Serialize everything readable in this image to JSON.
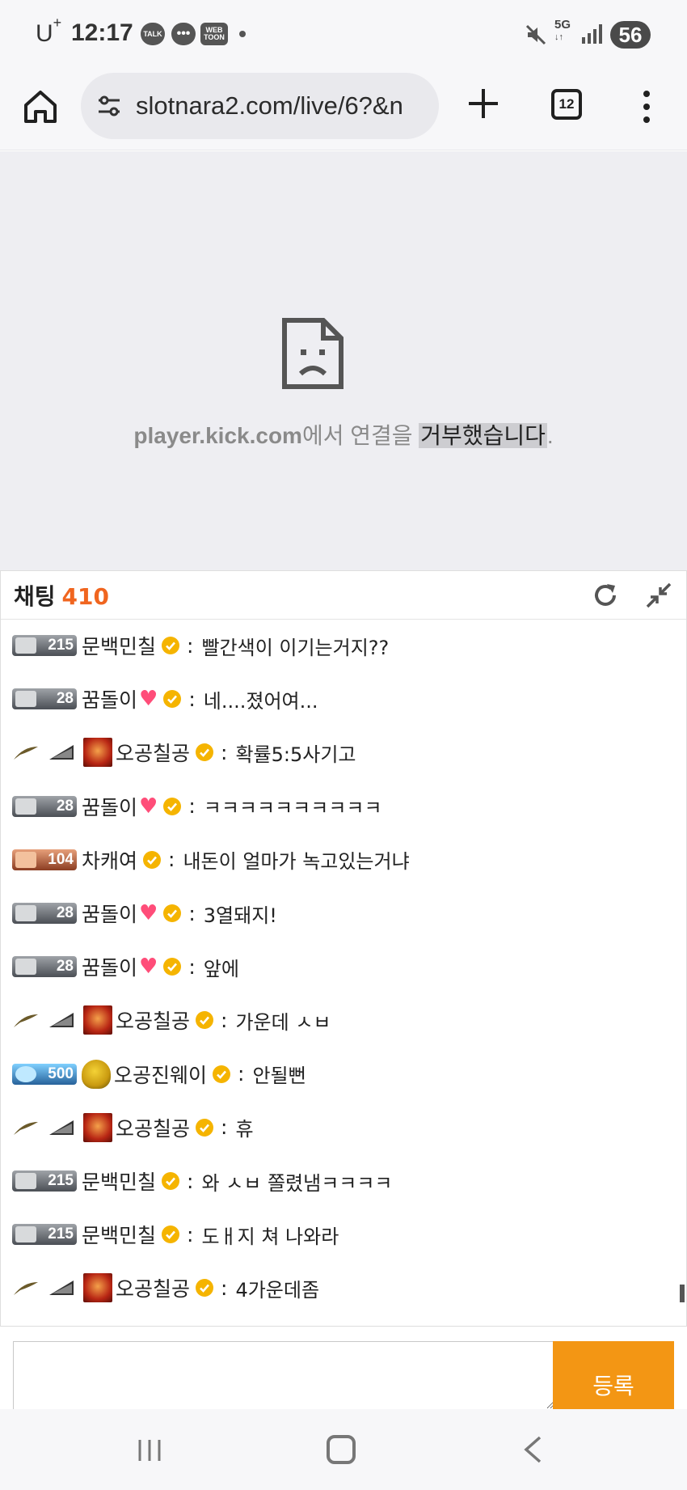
{
  "status_bar": {
    "carrier": "U",
    "carrier_sup": "+",
    "time": "12:17",
    "notifications": [
      "TALK",
      "chat",
      "WEB TOON"
    ],
    "network": "5G",
    "battery": "56"
  },
  "browser": {
    "url": "slotnara2.com/live/6?&n",
    "tab_count": "12"
  },
  "error": {
    "host": "player.kick.com",
    "text_mid": "에서 연결을 ",
    "text_highlight": "거부했습니다",
    "text_end": "."
  },
  "chat": {
    "title": "채팅",
    "count": "410",
    "messages": [
      {
        "badge": "215",
        "badge_style": "silver",
        "rank_icons": false,
        "avatar": null,
        "nick": "문백민칠",
        "heart": false,
        "text": "빨간색이 이기는거지??"
      },
      {
        "badge": "28",
        "badge_style": "silver",
        "rank_icons": false,
        "avatar": null,
        "nick": "꿈돌이",
        "heart": true,
        "text": "네....졌어여..."
      },
      {
        "badge": null,
        "badge_style": null,
        "rank_icons": true,
        "avatar": "red",
        "nick": "오공칠공",
        "heart": false,
        "text": "확률5:5사기고"
      },
      {
        "badge": "28",
        "badge_style": "silver",
        "rank_icons": false,
        "avatar": null,
        "nick": "꿈돌이",
        "heart": true,
        "text": "ㅋㅋㅋㅋㅋㅋㅋㅋㅋㅋ"
      },
      {
        "badge": "104",
        "badge_style": "gold",
        "rank_icons": false,
        "avatar": null,
        "nick": "차캐여",
        "heart": false,
        "text": "내돈이 얼마가 녹고있는거냐"
      },
      {
        "badge": "28",
        "badge_style": "silver",
        "rank_icons": false,
        "avatar": null,
        "nick": "꿈돌이",
        "heart": true,
        "text": "3열돼지!"
      },
      {
        "badge": "28",
        "badge_style": "silver",
        "rank_icons": false,
        "avatar": null,
        "nick": "꿈돌이",
        "heart": true,
        "text": "앞에"
      },
      {
        "badge": null,
        "badge_style": null,
        "rank_icons": true,
        "avatar": "red",
        "nick": "오공칠공",
        "heart": false,
        "text": "가운데 ㅅㅂ"
      },
      {
        "badge": "500",
        "badge_style": "blue",
        "rank_icons": false,
        "avatar": "bird",
        "nick": "오공진웨이",
        "heart": false,
        "text": "안될뻔"
      },
      {
        "badge": null,
        "badge_style": null,
        "rank_icons": true,
        "avatar": "red",
        "nick": "오공칠공",
        "heart": false,
        "text": "휴"
      },
      {
        "badge": "215",
        "badge_style": "silver",
        "rank_icons": false,
        "avatar": null,
        "nick": "문백민칠",
        "heart": false,
        "text": "와 ㅅㅂ 쫄렸냄ㅋㅋㅋㅋ"
      },
      {
        "badge": "215",
        "badge_style": "silver",
        "rank_icons": false,
        "avatar": null,
        "nick": "문백민칠",
        "heart": false,
        "text": "도ㅐ지 쳐 나와라"
      },
      {
        "badge": null,
        "badge_style": null,
        "rank_icons": true,
        "avatar": "red",
        "nick": "오공칠공",
        "heart": false,
        "text": "4가운데좀"
      }
    ],
    "submit_label": "등록",
    "input_value": ""
  },
  "colors": {
    "accent_orange": "#f39614",
    "count_orange": "#f0651f",
    "verified_gold": "#f5b400"
  }
}
